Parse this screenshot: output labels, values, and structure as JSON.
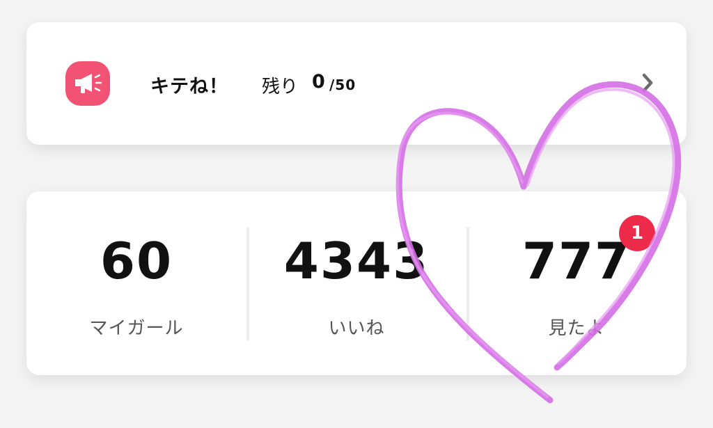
{
  "promo": {
    "icon": "megaphone-icon",
    "title": "キテね！",
    "remaining_label": "残り",
    "remaining_count": "0",
    "remaining_total": "/50",
    "chevron_icon": "chevron-right-icon"
  },
  "stats": [
    {
      "value": "60",
      "label": "マイガール"
    },
    {
      "value": "4343",
      "label": "いいね"
    },
    {
      "value": "777",
      "label": "見たよ",
      "badge": "1"
    }
  ],
  "colors": {
    "accent": "#f25374",
    "badge": "#ee2a4b",
    "heart": "#d46fe6"
  },
  "overlay": {
    "shape": "heart-doodle-icon"
  }
}
